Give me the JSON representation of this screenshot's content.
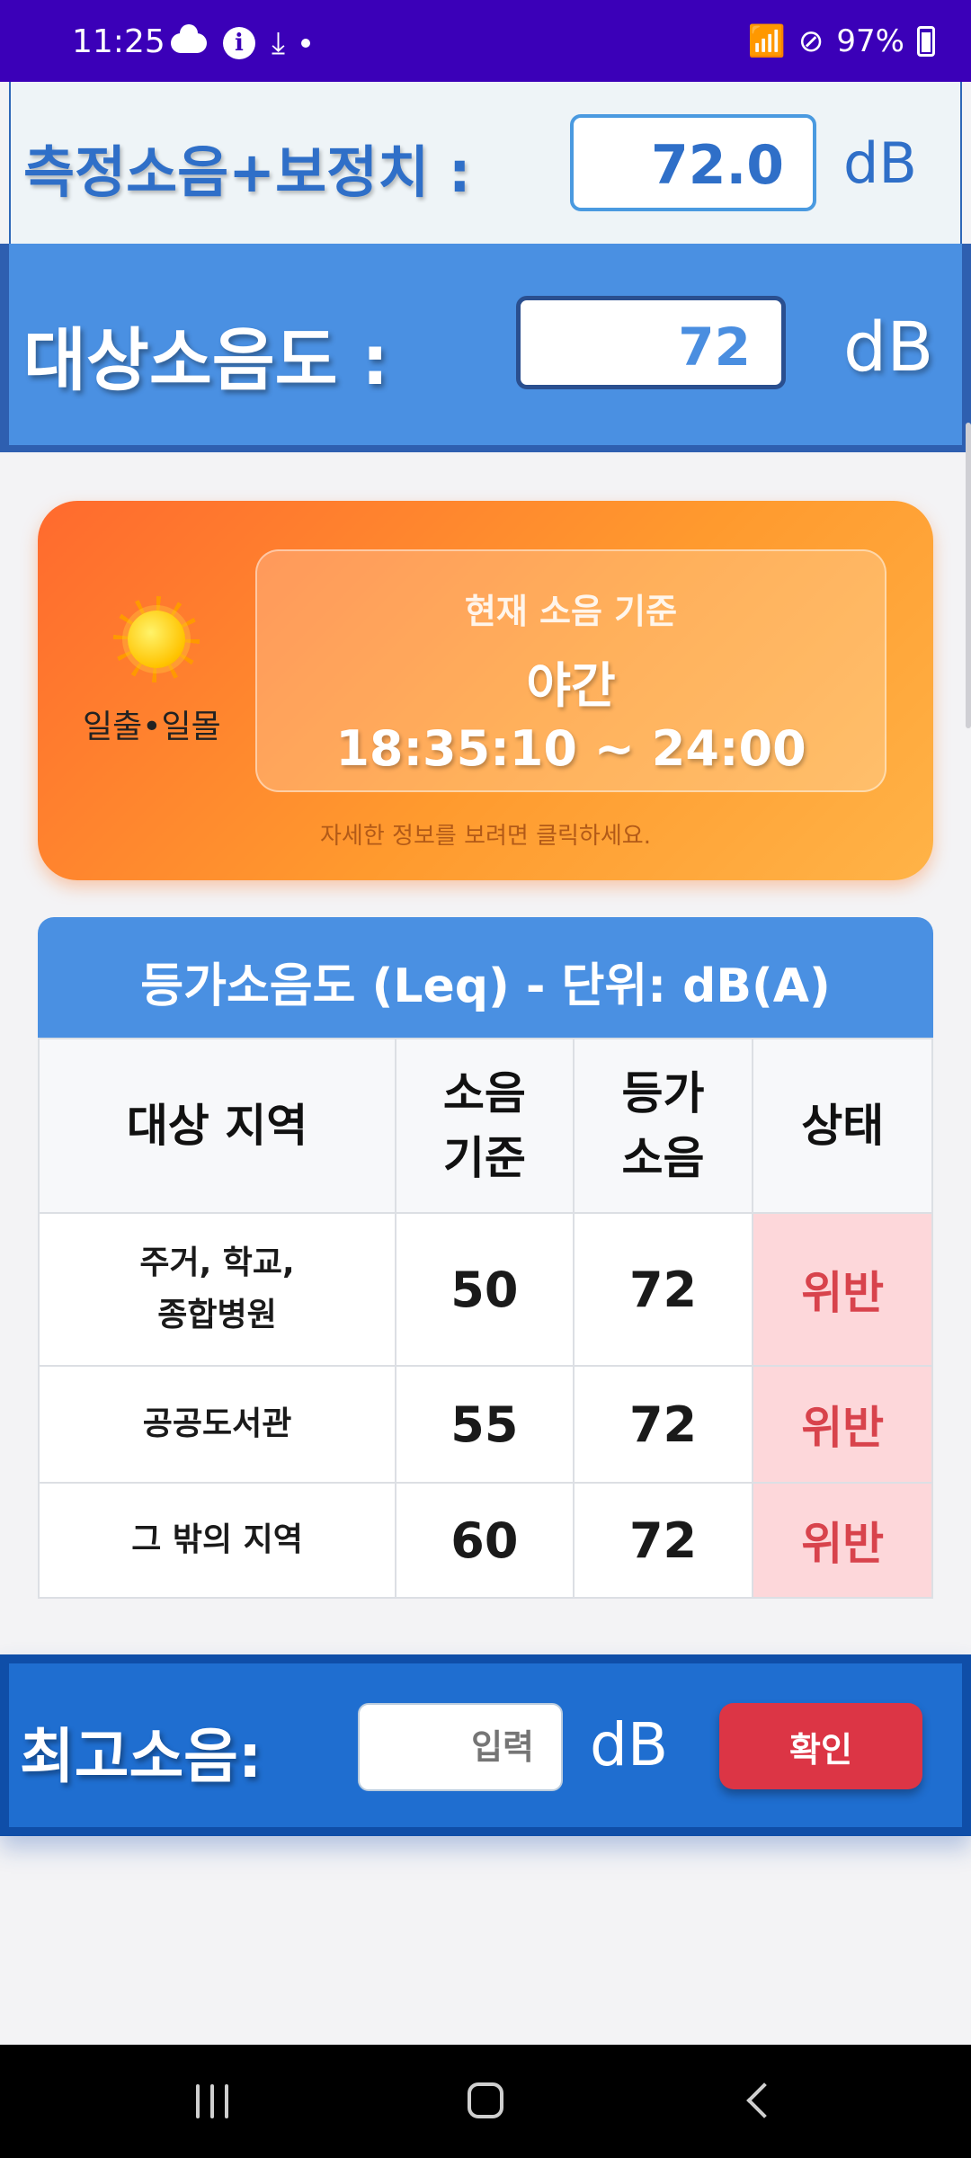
{
  "status_bar": {
    "time": "11:25",
    "battery": "97%"
  },
  "measurement": {
    "corrected_label": "측정소음+보정치 :",
    "corrected_value": "72.0",
    "corrected_unit": "dB",
    "target_label": "대상소음도 :",
    "target_value": "72",
    "target_unit": "dB"
  },
  "sun_card": {
    "sun_label": "일출•일몰",
    "title": "현재 소음 기준",
    "period": "야간",
    "time_range": "18:35:10 ~ 24:00",
    "hint": "자세한 정보를 보려면 클릭하세요."
  },
  "table": {
    "title": "등가소음도 (Leq) - 단위: dB(A)",
    "headers": {
      "area": "대상 지역",
      "standard_1": "소음",
      "standard_2": "기준",
      "equivalent_1": "등가",
      "equivalent_2": "소음",
      "status": "상태"
    },
    "rows": [
      {
        "area_1": "주거, 학교,",
        "area_2": "종합병원",
        "standard": "50",
        "equivalent": "72",
        "status": "위반"
      },
      {
        "area_1": "공공도서관",
        "standard": "55",
        "equivalent": "72",
        "status": "위반"
      },
      {
        "area_1": "그 밖의 지역",
        "standard": "60",
        "equivalent": "72",
        "status": "위반"
      }
    ]
  },
  "max_noise": {
    "label": "최고소음:",
    "placeholder": "입력",
    "unit": "dB",
    "confirm_label": "확인"
  },
  "colors": {
    "status_bar": "#3b00b8",
    "accent_blue": "#4a90e2",
    "violation_bg": "#fdd7da",
    "violation_text": "#d8434c",
    "confirm_button": "#dc3545"
  }
}
